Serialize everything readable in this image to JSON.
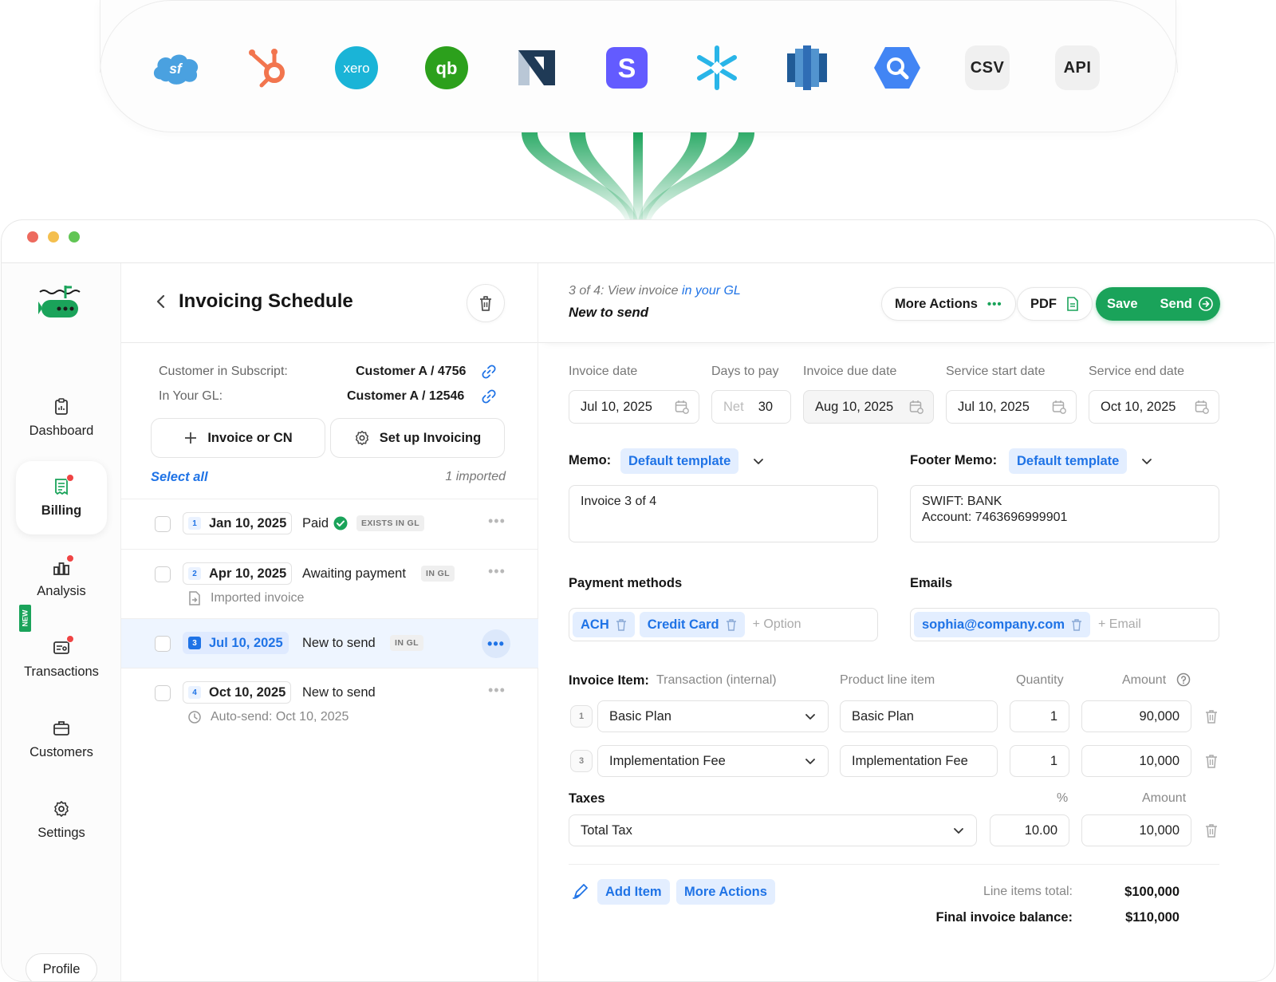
{
  "integrations": [
    {
      "name": "salesforce-logo",
      "label": "sf",
      "color": "#4aa1e0"
    },
    {
      "name": "hubspot-logo",
      "label": "",
      "color": "#f2754e"
    },
    {
      "name": "xero-logo",
      "label": "xero",
      "color": "#1ab4d7"
    },
    {
      "name": "quickbooks-logo",
      "label": "qb",
      "color": "#2ca01c"
    },
    {
      "name": "netsuite-logo",
      "label": "N",
      "color": "#1f3a56"
    },
    {
      "name": "stripe-logo",
      "label": "S",
      "color": "#635bff"
    },
    {
      "name": "snowflake-logo",
      "label": "",
      "color": "#29b5e8"
    },
    {
      "name": "redshift-logo",
      "label": "",
      "color": "#2f6db5"
    },
    {
      "name": "bigquery-logo",
      "label": "",
      "color": "#4285f4"
    },
    {
      "name": "csv-tile",
      "label": "CSV"
    },
    {
      "name": "api-tile",
      "label": "API"
    }
  ],
  "colors": {
    "accent_green": "#1aa35a",
    "accent_blue": "#1f73e6",
    "badge_red": "#ef4444"
  },
  "sidebar": {
    "items": [
      {
        "label": "Dashboard",
        "icon": "clipboard-icon",
        "badge": false
      },
      {
        "label": "Billing",
        "icon": "receipt-icon",
        "badge": true,
        "active": true
      },
      {
        "label": "Analysis",
        "icon": "chart-icon",
        "badge": true,
        "new": true
      },
      {
        "label": "Transactions",
        "icon": "transactions-icon",
        "badge": true
      },
      {
        "label": "Customers",
        "icon": "briefcase-icon",
        "badge": false
      },
      {
        "label": "Settings",
        "icon": "gear-icon",
        "badge": false
      }
    ],
    "new_label": "NEW",
    "profile_label": "Profile"
  },
  "schedule": {
    "title": "Invoicing Schedule",
    "customer_subscript_label": "Customer in Subscript:",
    "customer_subscript_value": "Customer A / 4756",
    "gl_label": "In Your GL:",
    "gl_value": "Customer A / 12546",
    "invoice_or_cn_label": "Invoice or CN",
    "setup_invoicing_label": "Set up Invoicing",
    "select_all_label": "Select all",
    "imported_count": "1 imported",
    "rows": [
      {
        "num": "1",
        "date": "Jan 10, 2025",
        "status": "Paid",
        "tag": "EXISTS IN GL",
        "sub": ""
      },
      {
        "num": "2",
        "date": "Apr 10, 2025",
        "status": "Awaiting payment",
        "tag": "IN GL",
        "sub": "Imported invoice"
      },
      {
        "num": "3",
        "date": "Jul 10, 2025",
        "status": "New to send",
        "tag": "IN GL",
        "sub": "",
        "selected": true
      },
      {
        "num": "4",
        "date": "Oct 10, 2025",
        "status": "New to send",
        "tag": "",
        "sub": "Auto-send: Oct 10, 2025"
      }
    ]
  },
  "detail": {
    "step_text": "3 of 4: View invoice",
    "step_link": "in your GL",
    "subtitle": "New to send",
    "more_actions_label": "More Actions",
    "pdf_label": "PDF",
    "save_label": "Save",
    "send_label": "Send",
    "dates": {
      "invoice_date_label": "Invoice date",
      "invoice_date": "Jul 10, 2025",
      "days_to_pay_label": "Days to pay",
      "days_prefix": "Net",
      "days_to_pay": "30",
      "due_date_label": "Invoice due date",
      "due_date": "Aug 10, 2025",
      "service_start_label": "Service start date",
      "service_start": "Jul 10, 2025",
      "service_end_label": "Service end date",
      "service_end": "Oct 10, 2025"
    },
    "memo_label": "Memo:",
    "memo_template": "Default template",
    "memo_text": "Invoice 3 of 4",
    "footer_memo_label": "Footer Memo:",
    "footer_template": "Default template",
    "footer_text": "SWIFT: BANK\nAccount: 7463696999901",
    "payment_methods_label": "Payment methods",
    "payment_methods": [
      "ACH",
      "Credit Card"
    ],
    "option_placeholder": "+ Option",
    "emails_label": "Emails",
    "emails": [
      "sophia@company.com"
    ],
    "email_placeholder": "+ Email",
    "invoice_item_label": "Invoice Item:",
    "col_transaction": "Transaction (internal)",
    "col_product": "Product line item",
    "col_quantity": "Quantity",
    "col_amount": "Amount",
    "items": [
      {
        "num": "1",
        "transaction": "Basic Plan",
        "product": "Basic Plan",
        "quantity": "1",
        "amount": "90,000"
      },
      {
        "num": "3",
        "transaction": "Implementation Fee",
        "product": "Implementation Fee",
        "quantity": "1",
        "amount": "10,000"
      }
    ],
    "taxes_label": "Taxes",
    "tax_pct_head": "%",
    "tax_amount_head": "Amount",
    "tax": {
      "name": "Total Tax",
      "pct": "10.00",
      "amount": "10,000"
    },
    "add_item_label": "Add Item",
    "more_actions_footer_label": "More Actions",
    "line_items_total_label": "Line items total:",
    "line_items_total": "$100,000",
    "final_balance_label": "Final invoice balance:",
    "final_balance": "$110,000"
  }
}
